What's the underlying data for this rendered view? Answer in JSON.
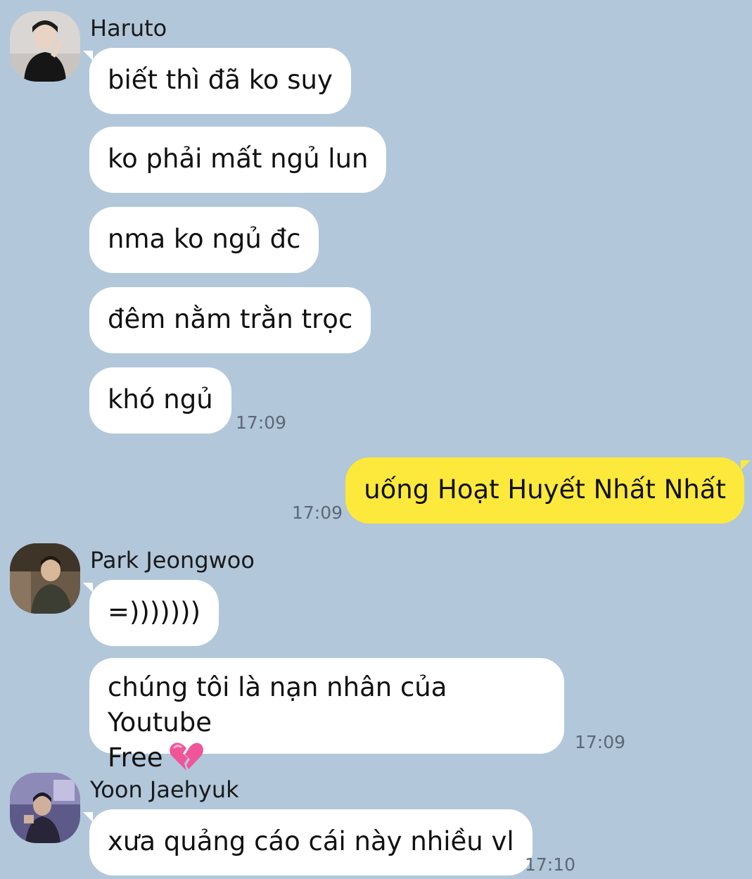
{
  "colors": {
    "background": "#b2c7da",
    "bubble_incoming": "#ffffff",
    "bubble_outgoing": "#fde93c",
    "timestamp": "#5c6877"
  },
  "messages": [
    {
      "sender": "Haruto",
      "avatar": "avatar-haruto",
      "bubbles": [
        "biết thì đã ko suy",
        "ko phải mất ngủ lun",
        "nma ko ngủ đc",
        "đêm nằm trằn trọc",
        "khó ngủ"
      ],
      "time": "17:09"
    },
    {
      "sender": "me",
      "bubbles": [
        "uống Hoạt Huyết Nhất Nhất"
      ],
      "time": "17:09"
    },
    {
      "sender": "Park Jeongwoo",
      "avatar": "avatar-park-jeongwoo",
      "bubbles": [
        "=)))))))",
        "chúng tôi là nạn nhân của Youtube",
        "Free"
      ],
      "emoji": "broken-heart-icon",
      "time": "17:09"
    },
    {
      "sender": "Yoon Jaehyuk",
      "avatar": "avatar-yoon-jaehyuk",
      "bubbles": [
        "xưa quảng cáo cái này nhiều vl"
      ],
      "time": "17:10"
    }
  ]
}
